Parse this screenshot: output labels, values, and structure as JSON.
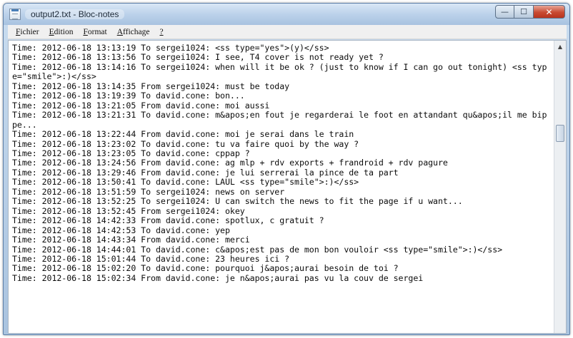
{
  "window": {
    "title": "output2.txt - Bloc-notes",
    "min_glyph": "—",
    "max_glyph": "☐",
    "close_glyph": "✕"
  },
  "menu": [
    {
      "underline": "F",
      "rest": "ichier"
    },
    {
      "underline": "E",
      "rest": "dition"
    },
    {
      "underline": "F",
      "rest": "ormat"
    },
    {
      "underline": "A",
      "rest": "ffichage"
    },
    {
      "underline": "?",
      "rest": ""
    }
  ],
  "lines": [
    "Time: 2012-06-18 13:13:19 To sergei1024: <ss type=\"yes\">(y)</ss>",
    "Time: 2012-06-18 13:13:56 To sergei1024: I see, T4 cover is not ready yet ?",
    "Time: 2012-06-18 13:14:16 To sergei1024: when will it be ok ? (just to know if I can go out tonight) <ss type=\"smile\">:)</ss>",
    "Time: 2012-06-18 13:14:35 From sergei1024: must be today",
    "Time: 2012-06-18 13:19:39 To david.cone: bon...",
    "Time: 2012-06-18 13:21:05 From david.cone: moi aussi",
    "Time: 2012-06-18 13:21:31 To david.cone: m&apos;en fout je regarderai le foot en attandant qu&apos;il me bippe...",
    "Time: 2012-06-18 13:22:44 From david.cone: moi je serai dans le train",
    "Time: 2012-06-18 13:23:02 To david.cone: tu va faire quoi by the way ?",
    "Time: 2012-06-18 13:23:05 To david.cone: cppap ?",
    "Time: 2012-06-18 13:24:56 From david.cone: ag mlp + rdv exports + frandroid + rdv pagure",
    "Time: 2012-06-18 13:29:46 From david.cone: je lui serrerai la pince de ta part",
    "Time: 2012-06-18 13:50:41 To david.cone: LAUL <ss type=\"smile\">:)</ss>",
    "Time: 2012-06-18 13:51:59 To sergei1024: news on server",
    "Time: 2012-06-18 13:52:25 To sergei1024: U can switch the news to fit the page if u want...",
    "Time: 2012-06-18 13:52:45 From sergei1024: okey",
    "Time: 2012-06-18 14:42:33 From david.cone: spotlux, c gratuit ?",
    "Time: 2012-06-18 14:42:53 To david.cone: yep",
    "Time: 2012-06-18 14:43:34 From david.cone: merci",
    "Time: 2012-06-18 14:44:01 To david.cone: c&apos;est pas de mon bon vouloir <ss type=\"smile\">:)</ss>",
    "Time: 2012-06-18 15:01:44 To david.cone: 23 heures ici ?",
    "Time: 2012-06-18 15:02:20 To david.cone: pourquoi j&apos;aurai besoin de toi ?",
    "Time: 2012-06-18 15:02:34 From david.cone: je n&apos;aurai pas vu la couv de sergei"
  ]
}
